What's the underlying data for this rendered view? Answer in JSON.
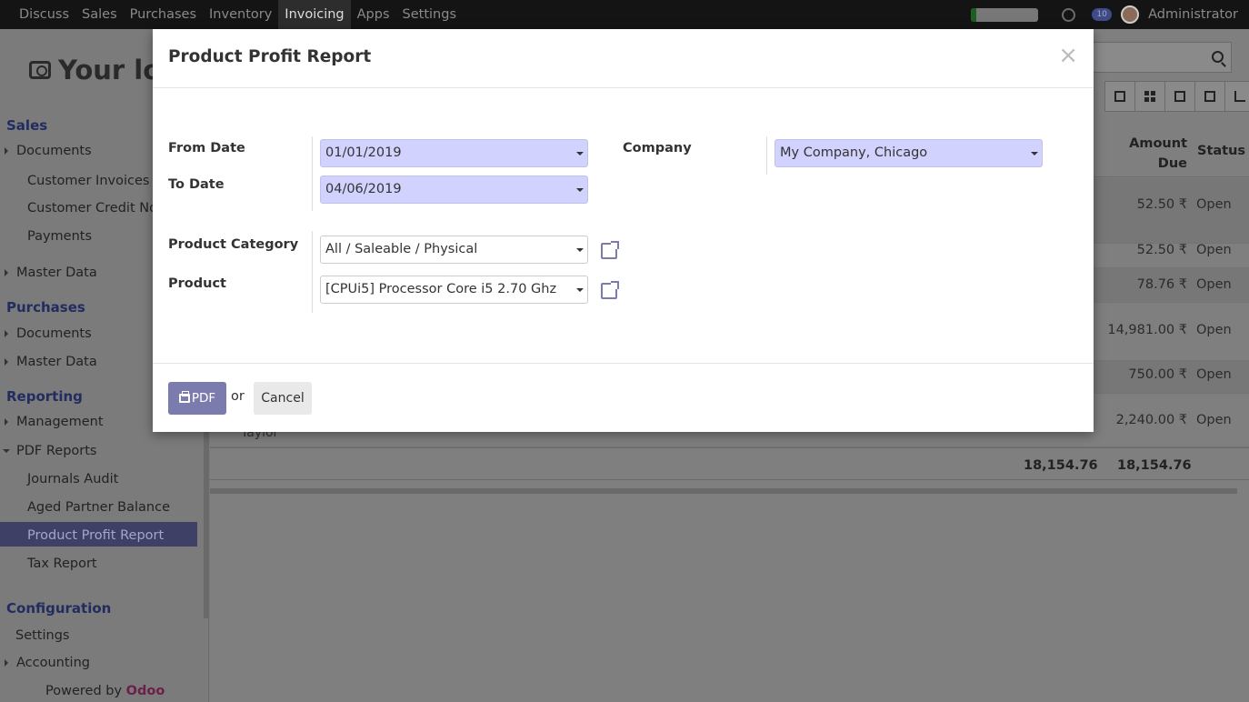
{
  "topbar": {
    "menu": [
      "Discuss",
      "Sales",
      "Purchases",
      "Inventory",
      "Invoicing",
      "Apps",
      "Settings"
    ],
    "active_menu": "Invoicing",
    "chat_badge": "10",
    "user_name": "Administrator",
    "progress_fraction": 0.08
  },
  "sidebar": {
    "logo_text": "Your log",
    "sales_header": "Sales",
    "sales_documents": "Documents",
    "customer_invoices": "Customer Invoices",
    "customer_credit": "Customer Credit No",
    "payments": "Payments",
    "sales_master_data": "Master Data",
    "purchases_header": "Purchases",
    "purchases_documents": "Documents",
    "purchases_master_data": "Master Data",
    "reporting_header": "Reporting",
    "management": "Management",
    "pdf_reports": "PDF Reports",
    "journals_audit": "Journals Audit",
    "aged_partner_balance": "Aged Partner Balance",
    "product_profit_report": "Product Profit Report",
    "tax_report": "Tax Report",
    "configuration_header": "Configuration",
    "settings": "Settings",
    "accounting": "Accounting",
    "powered_by": "Powered by",
    "powered_brand": "Odoo"
  },
  "background_table": {
    "col_amount_due_1": "Amount",
    "col_amount_due_2": "Due",
    "col_status": "Status",
    "rows": [
      {
        "amount": "52.50 ₹",
        "status": "Open"
      },
      {
        "amount": "52.50 ₹",
        "status": "Open"
      },
      {
        "amount": "78.76 ₹",
        "status": "Open"
      },
      {
        "amount": "14,981.00 ₹",
        "status": "Open"
      },
      {
        "amount": "750.00 ₹",
        "status": "Open"
      },
      {
        "amount": "2,240.00 ₹",
        "status": "Open"
      }
    ],
    "partial_name": "Taylor",
    "total_1": "18,154.76",
    "total_2": "18,154.76"
  },
  "modal": {
    "title": "Product Profit Report",
    "close_symbol": "×",
    "from_date_label": "From Date",
    "from_date_value": "01/01/2019",
    "to_date_label": "To Date",
    "to_date_value": "04/06/2019",
    "company_label": "Company",
    "company_value": "My Company, Chicago",
    "product_category_label": "Product Category",
    "product_category_value": "All / Saleable / Physical",
    "product_label": "Product",
    "product_value": "[CPUi5] Processor Core i5 2.70 Ghz",
    "pdf_label": "PDF",
    "or_label": "or",
    "cancel_label": "Cancel"
  }
}
